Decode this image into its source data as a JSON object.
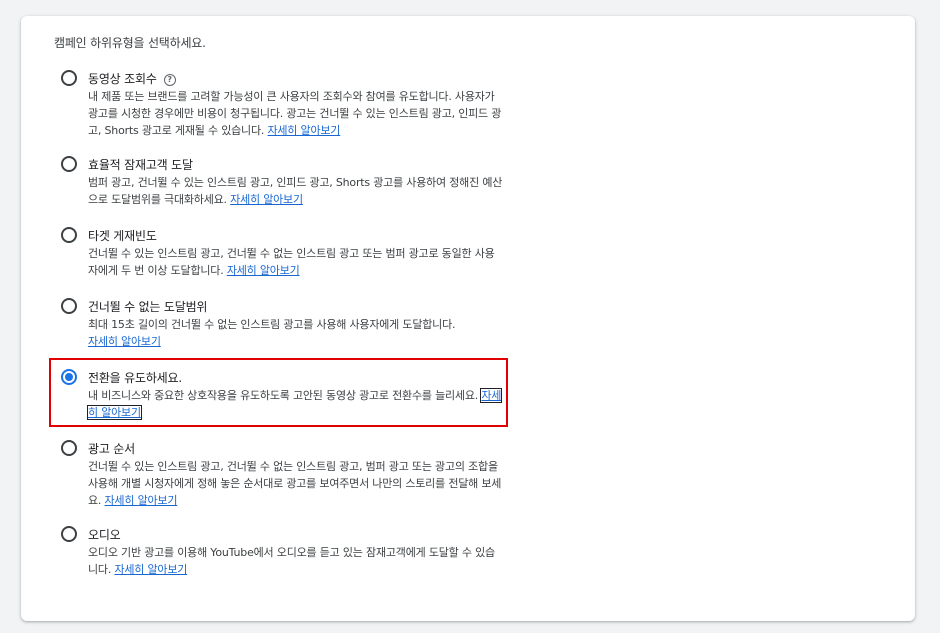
{
  "prompt": "캠페인 하위유형을 선택하세요.",
  "learn_more": "자세히 알아보기",
  "options": [
    {
      "title": "동영상 조회수",
      "has_help": true,
      "description": "내 제품 또는 브랜드를 고려할 가능성이 큰 사용자의 조회수와 참여를 유도합니다. 사용자가 광고를 시청한 경우에만 비용이 청구됩니다. 광고는 건너뛸 수 있는 인스트림 광고, 인피드 광고, Shorts 광고로 게재될 수 있습니다.",
      "selected": false
    },
    {
      "title": "효율적 잠재고객 도달",
      "description": "범퍼 광고, 건너뛸 수 있는 인스트림 광고, 인피드 광고, Shorts 광고를 사용하여 정해진 예산으로 도달범위를 극대화하세요.",
      "selected": false
    },
    {
      "title": "타겟 게재빈도",
      "description": "건너뛸 수 있는 인스트림 광고, 건너뛸 수 없는 인스트림 광고 또는 범퍼 광고로 동일한 사용자에게 두 번 이상 도달합니다.",
      "selected": false
    },
    {
      "title": "건너뛸 수 없는 도달범위",
      "description": "최대 15초 길이의 건너뛸 수 없는 인스트림 광고를 사용해 사용자에게 도달합니다.",
      "selected": false
    },
    {
      "title": "전환을 유도하세요.",
      "description": "내 비즈니스와 중요한 상호작용을 유도하도록 고안된 동영상 광고로 전환수를 늘리세요.",
      "selected": true
    },
    {
      "title": "광고 순서",
      "description": "건너뛸 수 있는 인스트림 광고, 건너뛸 수 없는 인스트림 광고, 범퍼 광고 또는 광고의 조합을 사용해 개별 시청자에게 정해 놓은 순서대로 광고를 보여주면서 나만의 스토리를 전달해 보세요.",
      "selected": false
    },
    {
      "title": "오디오",
      "description": "오디오 기반 광고를 이용해 YouTube에서 오디오를 듣고 있는 잠재고객에게 도달할 수 있습니다.",
      "selected": false
    }
  ],
  "colors": {
    "accent": "#1a73e8",
    "link": "#1967d2",
    "highlight": "#e00000"
  }
}
